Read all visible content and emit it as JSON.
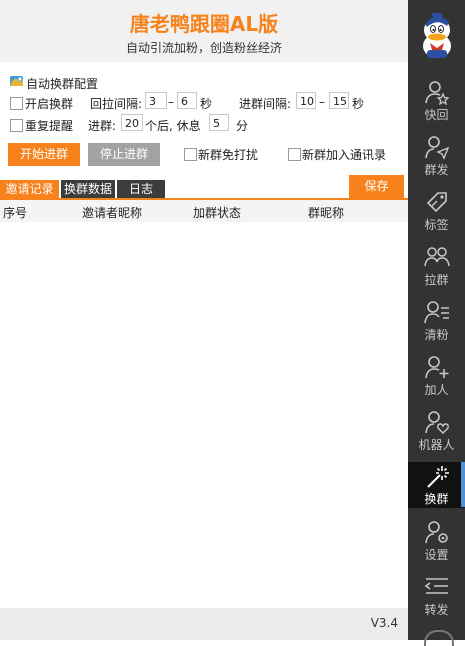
{
  "header": {
    "title": "唐老鸭跟圈AL版",
    "subtitle": "自动引流加粉，创造粉丝经济"
  },
  "config": {
    "section_title": "自动换群配置",
    "enable_label": "开启换群",
    "enable_checked": false,
    "pull_interval_label": "回拉间隔:",
    "pull_min": "3",
    "pull_max": "6",
    "dash": "–",
    "sec_unit": "秒",
    "join_interval_label": "进群间隔:",
    "join_min": "10",
    "join_max": "15",
    "repeat_label": "重复提醒",
    "repeat_checked": false,
    "join_label": "进群:",
    "join_count": "20",
    "rest_after_label": "个后, 休息",
    "rest_count": "5",
    "minute_unit": "分"
  },
  "actions": {
    "start_label": "开始进群",
    "stop_label": "停止进群",
    "mute_new_label": "新群免打扰",
    "mute_new_checked": false,
    "add_contacts_label": "新群加入通讯录",
    "add_contacts_checked": false
  },
  "tabs": [
    {
      "label": "邀请记录",
      "active": true
    },
    {
      "label": "换群数据",
      "active": false
    },
    {
      "label": "日志",
      "active": false
    }
  ],
  "save_label": "保存",
  "table": {
    "columns": [
      "序号",
      "邀请者昵称",
      "加群状态",
      "群昵称"
    ],
    "rows": []
  },
  "footer": {
    "version": "V3.4"
  },
  "sidebar": {
    "items": [
      {
        "label": "快回",
        "icon": "star-user-icon"
      },
      {
        "label": "群发",
        "icon": "send-icon"
      },
      {
        "label": "标签",
        "icon": "tag-icon"
      },
      {
        "label": "拉群",
        "icon": "group-icon"
      },
      {
        "label": "清粉",
        "icon": "clear-fans-icon"
      },
      {
        "label": "加人",
        "icon": "add-user-icon"
      },
      {
        "label": "机器人",
        "icon": "robot-icon"
      },
      {
        "label": "换群",
        "icon": "magic-wand-icon",
        "active": true
      },
      {
        "label": "设置",
        "icon": "user-settings-icon"
      },
      {
        "label": "转发",
        "icon": "forward-icon"
      }
    ]
  },
  "colors": {
    "accent": "#f7821b",
    "sidebar_bg": "#333333",
    "sidebar_active_bar": "#4f8fd8"
  }
}
